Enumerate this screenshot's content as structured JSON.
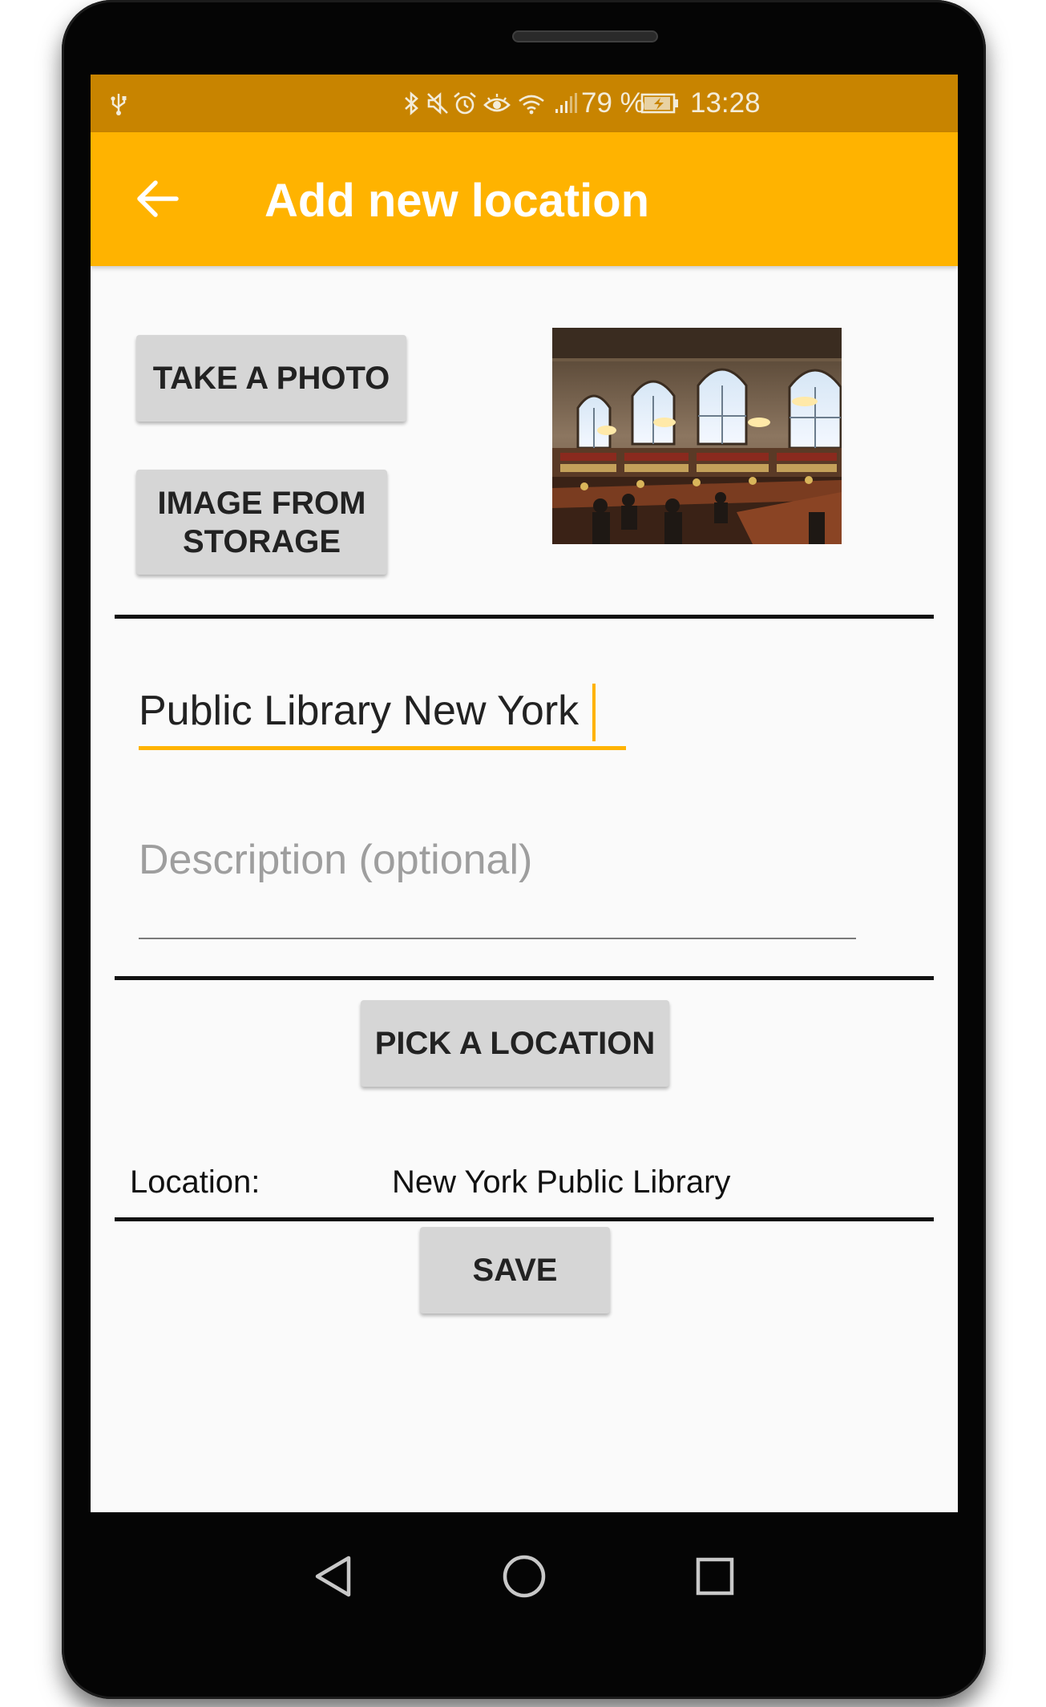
{
  "status_bar": {
    "battery_percent": "79 %",
    "time": "13:28",
    "icons": [
      "usb-icon",
      "bluetooth-icon",
      "mute-icon",
      "alarm-icon",
      "eye-comfort-icon",
      "wifi-icon",
      "signal-icon",
      "battery-charging-icon"
    ]
  },
  "app_bar": {
    "title": "Add new location",
    "back_icon": "arrow-back-icon",
    "color": "#ffb300"
  },
  "photo_section": {
    "take_photo_label": "TAKE A PHOTO",
    "image_from_storage_label": "IMAGE FROM STORAGE",
    "photo_subject": "library reading room"
  },
  "form": {
    "name_value": "Public Library New York",
    "description_placeholder": "Description (optional)"
  },
  "location_section": {
    "pick_location_label": "PICK A LOCATION",
    "location_label": "Location:",
    "location_value": "New York Public Library"
  },
  "actions": {
    "save_label": "SAVE"
  },
  "nav_bar": {
    "icons": [
      "back-triangle-icon",
      "home-circle-icon",
      "recents-square-icon"
    ]
  },
  "colors": {
    "accent": "#ffb300",
    "status_bar": "#c88400",
    "button": "#d6d6d6",
    "background": "#fafafa"
  }
}
